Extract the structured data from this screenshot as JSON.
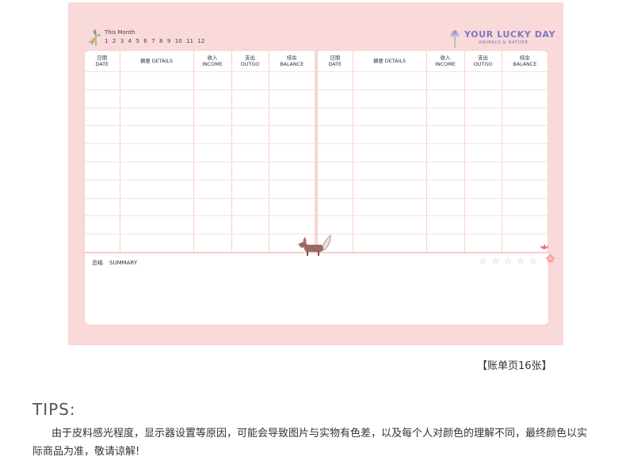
{
  "sheet": {
    "this_month_label": "This Month",
    "months": [
      "1",
      "2",
      "3",
      "4",
      "5",
      "6",
      "7",
      "8",
      "9",
      "10",
      "11",
      "12"
    ],
    "brand_title": "YOUR LUCKY DAY",
    "brand_subtitle": "ANIMALS & NATURE",
    "columns": [
      {
        "cn": "日期",
        "en": "DATE"
      },
      {
        "cn": "摘要",
        "en": "DETAILS"
      },
      {
        "cn": "收入",
        "en": "INCOME"
      },
      {
        "cn": "支出",
        "en": "OUTGO"
      },
      {
        "cn": "结余",
        "en": "BALANCE"
      }
    ],
    "row_count": 10,
    "summary_cn": "总结",
    "summary_en": "SUMMARY",
    "star_count": 5,
    "colors": {
      "sheet_bg": "#f9d9d9",
      "brand": "#7b78c6",
      "grid": "#f7d0cd"
    }
  },
  "caption": "【账单页16张】",
  "tips": {
    "title": "TIPS:",
    "body": "由于皮料感光程度，显示器设置等原因，可能会导致图片与实物有色差，以及每个人对颜色的理解不同，最终颜色以实际商品为准，敬请谅解!"
  }
}
